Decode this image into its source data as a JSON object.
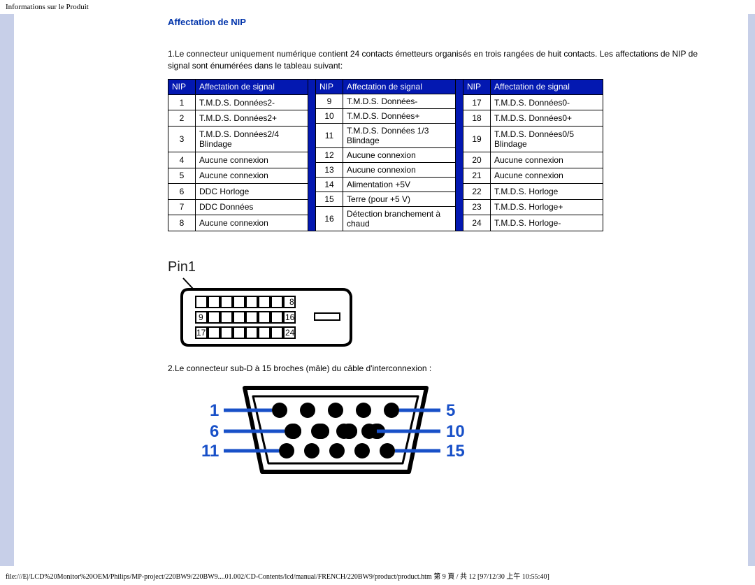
{
  "page_header": "Informations sur le Produit",
  "section_title": "Affectation de NIP",
  "intro_para": "1.Le connecteur uniquement numérique contient 24 contacts émetteurs organisés en trois rangées de huit contacts. Les affectations de NIP de signal sont énumérées dans le tableau suivant:",
  "table_headers": {
    "nip": "NIP",
    "sig": "Affectation de signal"
  },
  "pins_col1": [
    {
      "n": "1",
      "s": "T.M.D.S. Données2-"
    },
    {
      "n": "2",
      "s": "T.M.D.S. Données2+"
    },
    {
      "n": "3",
      "s": "T.M.D.S. Données2/4 Blindage"
    },
    {
      "n": "4",
      "s": "Aucune connexion"
    },
    {
      "n": "5",
      "s": "Aucune connexion"
    },
    {
      "n": "6",
      "s": "DDC Horloge"
    },
    {
      "n": "7",
      "s": "DDC Données"
    },
    {
      "n": "8",
      "s": "Aucune connexion"
    }
  ],
  "pins_col2": [
    {
      "n": "9",
      "s": "T.M.D.S. Données-"
    },
    {
      "n": "10",
      "s": "T.M.D.S. Données+"
    },
    {
      "n": "11",
      "s": "T.M.D.S. Données 1/3 Blindage"
    },
    {
      "n": "12",
      "s": "Aucune connexion"
    },
    {
      "n": "13",
      "s": "Aucune connexion"
    },
    {
      "n": "14",
      "s": "Alimentation +5V"
    },
    {
      "n": "15",
      "s": "Terre (pour +5 V)"
    },
    {
      "n": "16",
      "s": "Détection branchement à chaud"
    }
  ],
  "pins_col3": [
    {
      "n": "17",
      "s": "T.M.D.S. Données0-"
    },
    {
      "n": "18",
      "s": "T.M.D.S. Données0+"
    },
    {
      "n": "19",
      "s": "T.M.D.S. Données0/5 Blindage"
    },
    {
      "n": "20",
      "s": "Aucune connexion"
    },
    {
      "n": "21",
      "s": "Aucune connexion"
    },
    {
      "n": "22",
      "s": "T.M.D.S. Horloge"
    },
    {
      "n": "23",
      "s": "T.M.D.S. Horloge+"
    },
    {
      "n": "24",
      "s": "T.M.D.S. Horloge-"
    }
  ],
  "dvi_label": "Pin1",
  "dvi_row_labels": {
    "top_right": "8",
    "mid_left": "9",
    "mid_right": "16",
    "bot_left": "17",
    "bot_right": "24"
  },
  "para2": "2.Le connecteur sub-D à 15 broches (mâle) du câble d'interconnexion :",
  "vga_labels": {
    "l1": "1",
    "l2": "6",
    "l3": "11",
    "r1": "5",
    "r2": "10",
    "r3": "15"
  },
  "footer": "file:///E|/LCD%20Monitor%20OEM/Philips/MP-project/220BW9/220BW9....01.002/CD-Contents/lcd/manual/FRENCH/220BW9/product/product.htm 第 9 頁 / 共 12  [97/12/30 上午 10:55:40]"
}
